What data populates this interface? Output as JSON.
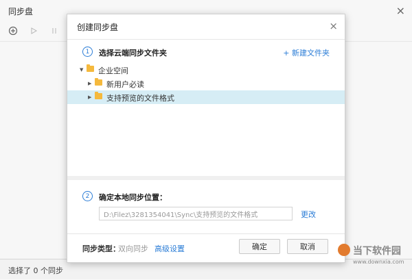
{
  "background_window": {
    "title": "同步盘",
    "close_icon": "×",
    "toolbar": {
      "add_icon": "add-sync-icon",
      "play_icon": "play-icon",
      "pause_icon": "pause-icon"
    },
    "status": "选择了 0 个同步"
  },
  "dialog": {
    "title": "创建同步盘",
    "close_icon": "×",
    "step1": {
      "number": "1",
      "label": "选择云端同步文件夹"
    },
    "new_folder_link": "+ 新建文件夹",
    "tree": [
      {
        "label": "企业空间",
        "level": 0,
        "expanded": true,
        "selected": false
      },
      {
        "label": "新用户必读",
        "level": 1,
        "expanded": false,
        "selected": false
      },
      {
        "label": "支持预览的文件格式",
        "level": 1,
        "expanded": false,
        "selected": true
      }
    ],
    "step2": {
      "number": "2",
      "label": "确定本地同步位置："
    },
    "local_path": "D:\\Filez\\3281354041\\Sync\\支持预览的文件格式",
    "change_link": "更改",
    "sync_type_label": "同步类型：",
    "sync_type_value": "双向同步",
    "advanced_link": "高级设置",
    "ok_button": "确定",
    "cancel_button": "取消"
  },
  "watermark": {
    "text": "当下软件园",
    "url": "www.downxia.com"
  },
  "colors": {
    "accent": "#2a7cd6",
    "selected_row": "#d6edf5",
    "folder": "#f5b93d"
  }
}
